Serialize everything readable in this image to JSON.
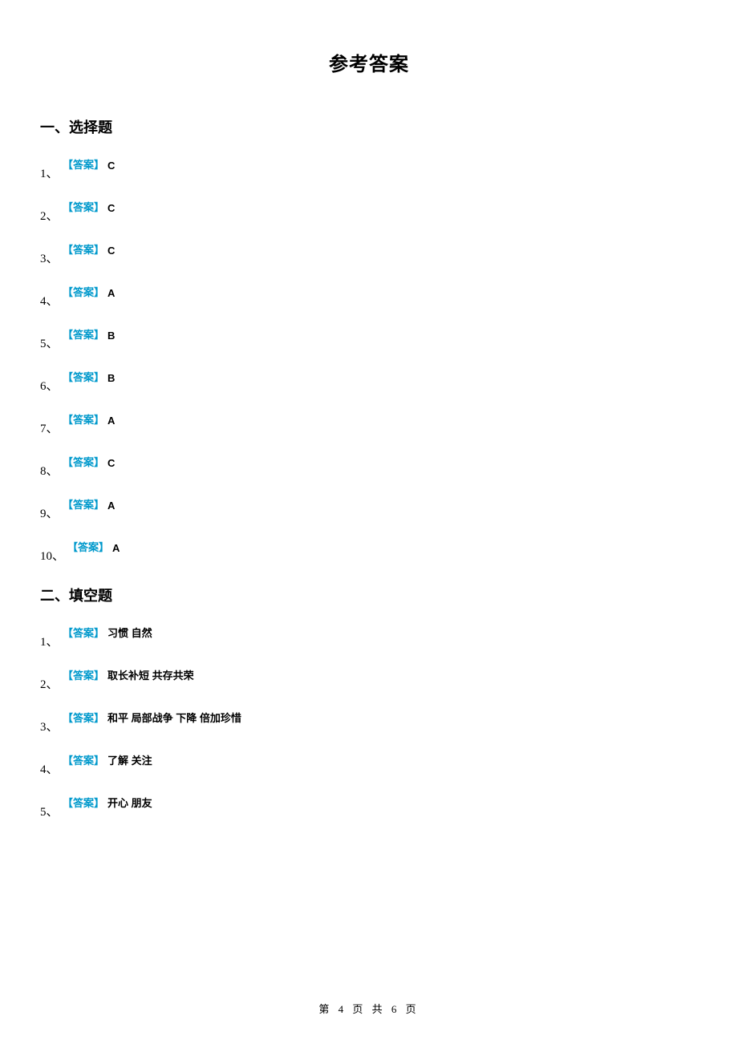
{
  "title": "参考答案",
  "answer_label": "【答案】",
  "section1": {
    "header": "一、选择题",
    "items": [
      {
        "num": "1、",
        "value": "C"
      },
      {
        "num": "2、",
        "value": "C"
      },
      {
        "num": "3、",
        "value": "C"
      },
      {
        "num": "4、",
        "value": "A"
      },
      {
        "num": "5、",
        "value": "B"
      },
      {
        "num": "6、",
        "value": "B"
      },
      {
        "num": "7、",
        "value": "A"
      },
      {
        "num": "8、",
        "value": "C"
      },
      {
        "num": "9、",
        "value": "A"
      },
      {
        "num": "10、",
        "value": "A"
      }
    ]
  },
  "section2": {
    "header": "二、填空题",
    "items": [
      {
        "num": "1、",
        "value": "习惯 自然"
      },
      {
        "num": "2、",
        "value": "取长补短 共存共荣"
      },
      {
        "num": "3、",
        "value": "和平 局部战争 下降 倍加珍惜"
      },
      {
        "num": "4、",
        "value": "了解 关注"
      },
      {
        "num": "5、",
        "value": "开心 朋友"
      }
    ]
  },
  "footer": "第 4 页 共 6 页"
}
